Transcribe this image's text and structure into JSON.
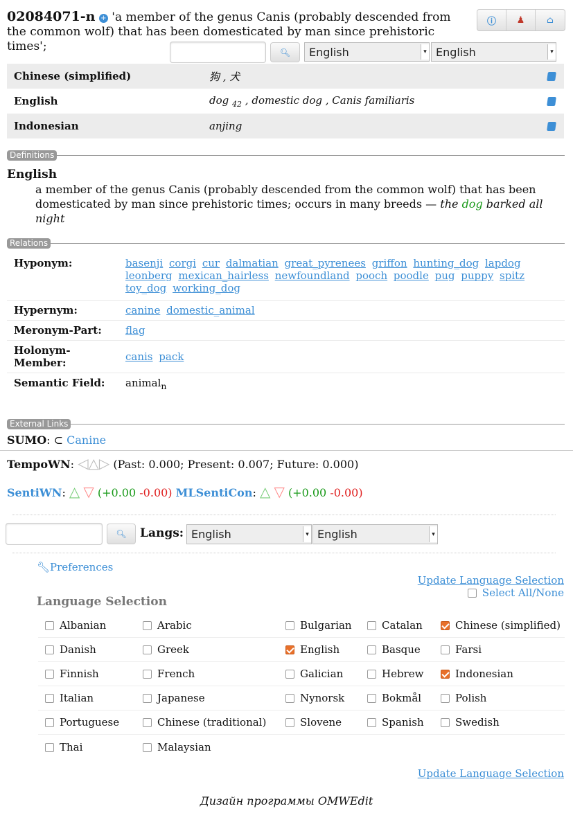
{
  "header": {
    "synset_id": "02084071-n",
    "gloss": "'a member of the genus Canis (probably descended from the common wolf) that has been domesticated by man since prehistoric times';",
    "buttons": [
      "info-icon",
      "user-icon",
      "home-icon"
    ]
  },
  "search": {
    "value": "",
    "lang1": "English",
    "lang2": "English"
  },
  "lemmas": [
    {
      "lang": "Chinese (simplified)",
      "words": "狗 , 犬"
    },
    {
      "lang": "English",
      "words": "dog",
      "sub": "42",
      "rest": " , domestic dog , Canis familiaris"
    },
    {
      "lang": "Indonesian",
      "words": "anjing"
    }
  ],
  "definitions": {
    "section": "Definitions",
    "lang": "English",
    "text": "a member of the genus Canis (probably descended from the common wolf) that has been domesticated by man since prehistoric times; occurs in many breeds — ",
    "ex_pre": "the ",
    "ex_word": "dog",
    "ex_post": " barked all night"
  },
  "relations": {
    "section": "Relations",
    "rows": [
      {
        "label": "Hyponym:",
        "links": [
          "basenji",
          "corgi",
          "cur",
          "dalmatian",
          "great_pyrenees",
          "griffon",
          "hunting_dog",
          "lapdog",
          "leonberg",
          "mexican_hairless",
          "newfoundland",
          "pooch",
          "poodle",
          "pug",
          "puppy",
          "spitz",
          "toy_dog",
          "working_dog"
        ]
      },
      {
        "label": "Hypernym:",
        "links": [
          "canine",
          "domestic_animal"
        ]
      },
      {
        "label": "Meronym-Part:",
        "links": [
          "flag"
        ]
      },
      {
        "label": "Holonym-Member:",
        "links": [
          "canis",
          "pack"
        ]
      }
    ],
    "semantic_field": {
      "label": "Semantic Field:",
      "value": "animal",
      "sub": "n"
    }
  },
  "external": {
    "section": "External Links",
    "sumo_label": "SUMO",
    "sumo_rel": "⊂",
    "sumo_link": "Canine"
  },
  "tempo": {
    "label": "TempoWN",
    "text": "(Past: 0.000; Present: 0.007; Future: 0.000)"
  },
  "senti": {
    "label": "SentiWN",
    "pos": "(+0.00",
    "neg": "-0.00)",
    "ml_label": "MLSentiCon",
    "ml_pos": "(+0.00",
    "ml_neg": "-0.00)"
  },
  "search2": {
    "value": "",
    "langs_label": "Langs:",
    "lang1": "English",
    "lang2": "English"
  },
  "prefs": {
    "label": "Preferences",
    "update": "Update Language Selection",
    "select_all": "Select All/None",
    "heading": "Language Selection"
  },
  "languages": [
    [
      {
        "n": "Albanian",
        "c": false
      },
      {
        "n": "Arabic",
        "c": false
      },
      {
        "n": "Bulgarian",
        "c": false
      },
      {
        "n": "Catalan",
        "c": false
      },
      {
        "n": "Chinese (simplified)",
        "c": true
      }
    ],
    [
      {
        "n": "Danish",
        "c": false
      },
      {
        "n": "Greek",
        "c": false
      },
      {
        "n": "English",
        "c": true
      },
      {
        "n": "Basque",
        "c": false
      },
      {
        "n": "Farsi",
        "c": false
      }
    ],
    [
      {
        "n": "Finnish",
        "c": false
      },
      {
        "n": "French",
        "c": false
      },
      {
        "n": "Galician",
        "c": false
      },
      {
        "n": "Hebrew",
        "c": false
      },
      {
        "n": "Indonesian",
        "c": true
      }
    ],
    [
      {
        "n": "Italian",
        "c": false
      },
      {
        "n": "Japanese",
        "c": false
      },
      {
        "n": "Nynorsk",
        "c": false
      },
      {
        "n": "Bokmål",
        "c": false
      },
      {
        "n": "Polish",
        "c": false
      }
    ],
    [
      {
        "n": "Portuguese",
        "c": false
      },
      {
        "n": "Chinese (traditional)",
        "c": false
      },
      {
        "n": "Slovene",
        "c": false
      },
      {
        "n": "Spanish",
        "c": false
      },
      {
        "n": "Swedish",
        "c": false
      }
    ],
    [
      {
        "n": "Thai",
        "c": false
      },
      {
        "n": "Malaysian",
        "c": false
      }
    ]
  ],
  "caption": "Дизайн программы OMWEdit",
  "colors": {
    "link": "#3d8fd6",
    "checked": "#e8702a",
    "positive": "#1a9a1a",
    "negative": "#e02020"
  }
}
